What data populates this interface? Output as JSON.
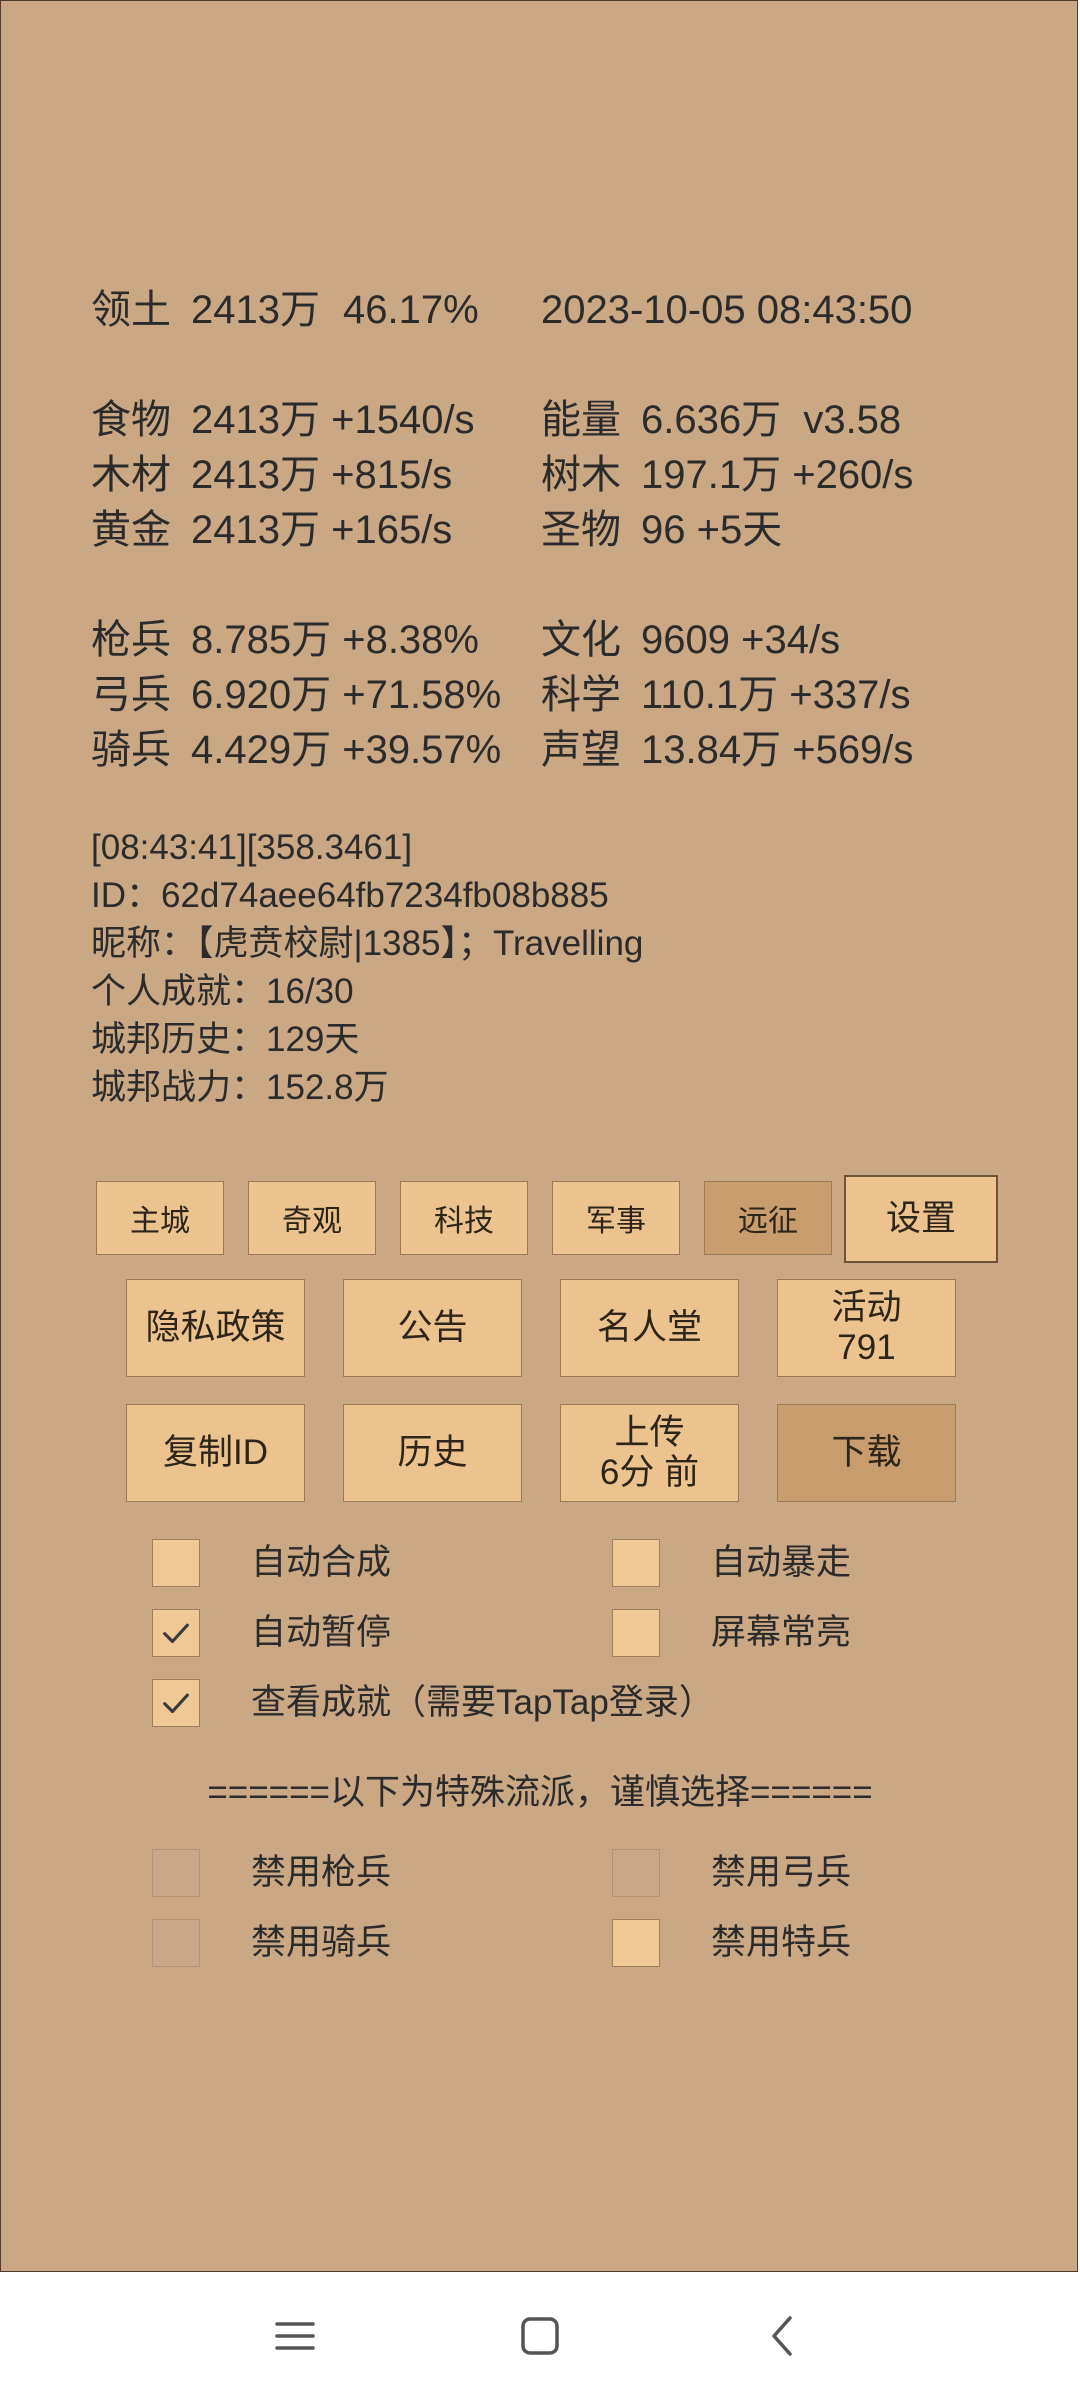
{
  "header": {
    "territory_label": "领土",
    "territory_value": "2413万",
    "territory_percent": "46.17%",
    "datetime": "2023-10-05 08:43:50"
  },
  "resources": [
    {
      "label": "食物",
      "value": "2413万 +1540/s"
    },
    {
      "label": "木材",
      "value": "2413万 +815/s"
    },
    {
      "label": "黄金",
      "value": "2413万 +165/s"
    },
    {
      "label": "能量",
      "value": "6.636万  v3.58"
    },
    {
      "label": "树木",
      "value": "197.1万 +260/s"
    },
    {
      "label": "圣物",
      "value": "96 +5天"
    }
  ],
  "army": [
    {
      "label": "枪兵",
      "value": "8.785万 +8.38%"
    },
    {
      "label": "弓兵",
      "value": "6.920万 +71.58%"
    },
    {
      "label": "骑兵",
      "value": "4.429万 +39.57%"
    },
    {
      "label": "文化",
      "value": "9609 +34/s"
    },
    {
      "label": "科学",
      "value": "110.1万 +337/s"
    },
    {
      "label": "声望",
      "value": "13.84万 +569/s"
    }
  ],
  "info": {
    "log_line": "[08:43:41][358.3461]",
    "id_line": "ID：62d74aee64fb7234fb08b885",
    "nickname_line": "昵称：【虎贲校尉|1385】；Travelling",
    "achievement_line": "个人成就：16/30",
    "history_line": "城邦历史：129天",
    "power_line": "城邦战力：152.8万"
  },
  "tabs": {
    "main_city": "主城",
    "wonders": "奇观",
    "tech": "科技",
    "military": "军事",
    "expedition": "远征",
    "settings": "设置"
  },
  "actions": {
    "privacy": "隐私政策",
    "notice": "公告",
    "hall_of_fame": "名人堂",
    "activity_label": "活动",
    "activity_count": "791",
    "copy_id": "复制ID",
    "history": "历史",
    "upload_label": "上传",
    "upload_time": "6分 前",
    "download": "下载"
  },
  "options": {
    "auto_synth": {
      "label": "自动合成",
      "checked": false
    },
    "auto_rampage": {
      "label": "自动暴走",
      "checked": false
    },
    "auto_pause": {
      "label": "自动暂停",
      "checked": true
    },
    "screen_on": {
      "label": "屏幕常亮",
      "checked": false
    },
    "view_achievements": {
      "label": "查看成就（需要TapTap登录）",
      "checked": true
    }
  },
  "special_divider": "======以下为特殊流派，谨慎选择======",
  "special": {
    "disable_spear": {
      "label": "禁用枪兵",
      "checked": false
    },
    "disable_archer": {
      "label": "禁用弓兵",
      "checked": false
    },
    "disable_cavalry": {
      "label": "禁用骑兵",
      "checked": false
    },
    "disable_special": {
      "label": "禁用特兵",
      "checked": false
    }
  },
  "navbar": {
    "menu_icon": "menu-icon",
    "home_icon": "home-icon",
    "back_icon": "back-icon"
  }
}
